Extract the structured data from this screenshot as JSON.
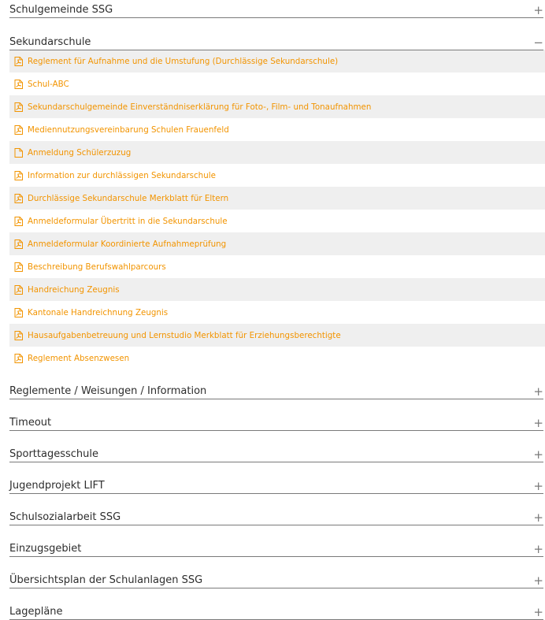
{
  "colors": {
    "link": "#f29400",
    "alt_row": "#efefef",
    "rule": "#7a7a7a",
    "heading": "#2d2d2d"
  },
  "top_section": {
    "title": "Schulgemeinde SSG",
    "toggle": "+",
    "expanded": false
  },
  "sekundarschule": {
    "title": "Sekundarschule",
    "toggle": "−",
    "expanded": true,
    "documents": [
      {
        "label": "Reglement für Aufnahme und die Umstufung (Durchlässige Sekundarschule)",
        "icon": "pdf-icon"
      },
      {
        "label": "Schul-ABC",
        "icon": "pdf-icon"
      },
      {
        "label": "Sekundarschulgemeinde Einverständniserklärung für Foto-, Film- und Tonaufnahmen",
        "icon": "pdf-icon"
      },
      {
        "label": "Mediennutzungsvereinbarung Schulen Frauenfeld",
        "icon": "pdf-icon"
      },
      {
        "label": "Anmeldung Schülerzuzug",
        "icon": "document-icon"
      },
      {
        "label": "Information zur durchlässigen Sekundarschule",
        "icon": "pdf-icon"
      },
      {
        "label": "Durchlässige Sekundarschule Merkblatt für Eltern",
        "icon": "pdf-icon"
      },
      {
        "label": "Anmeldeformular Übertritt in die Sekundarschule",
        "icon": "pdf-icon"
      },
      {
        "label": "Anmeldeformular Koordinierte Aufnahmeprüfung",
        "icon": "pdf-icon"
      },
      {
        "label": "Beschreibung Berufswahlparcours",
        "icon": "pdf-icon"
      },
      {
        "label": "Handreichung Zeugnis",
        "icon": "pdf-icon"
      },
      {
        "label": "Kantonale Handreichnung Zeugnis",
        "icon": "pdf-icon"
      },
      {
        "label": "Hausaufgabenbetreuung und Lernstudio Merkblatt für Erziehungsberechtigte",
        "icon": "pdf-icon"
      },
      {
        "label": "Reglement Absenzwesen",
        "icon": "pdf-icon"
      }
    ]
  },
  "collapsed_sections": [
    {
      "title": "Reglemente / Weisungen / Information",
      "toggle": "+"
    },
    {
      "title": "Timeout",
      "toggle": "+"
    },
    {
      "title": "Sporttagesschule",
      "toggle": "+"
    },
    {
      "title": "Jugendprojekt LIFT",
      "toggle": "+"
    },
    {
      "title": "Schulsozialarbeit SSG",
      "toggle": "+"
    },
    {
      "title": "Einzugsgebiet",
      "toggle": "+"
    },
    {
      "title": "Übersichtsplan der Schulanlagen SSG",
      "toggle": "+"
    },
    {
      "title": "Lagepläne",
      "toggle": "+"
    }
  ]
}
